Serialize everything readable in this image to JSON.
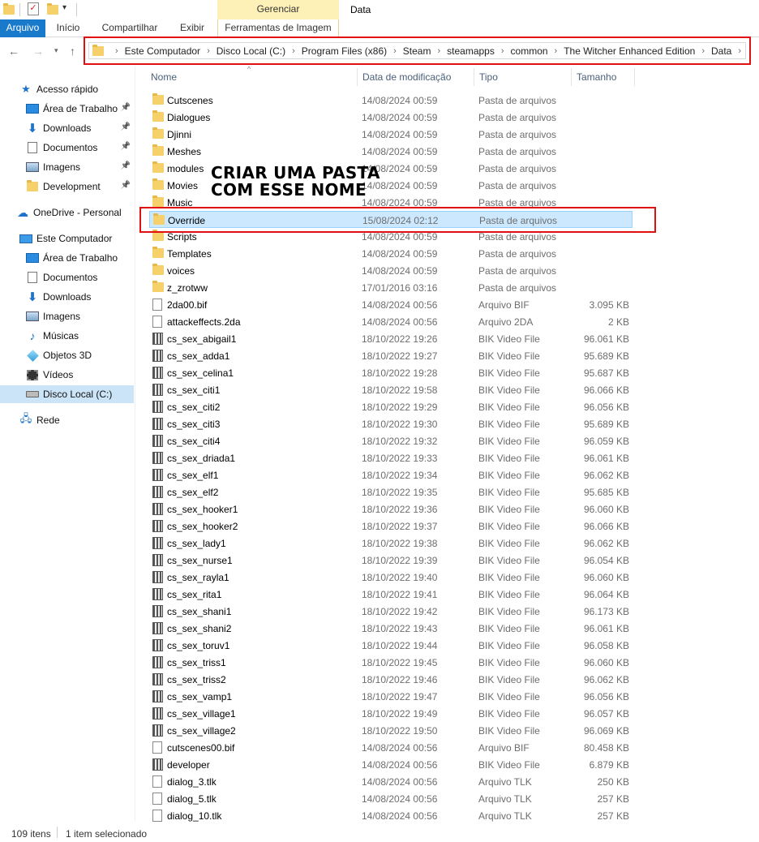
{
  "ribbon": {
    "manage_label": "Gerenciar",
    "window_title": "Data",
    "tabs": [
      "Arquivo",
      "Início",
      "Compartilhar",
      "Exibir"
    ],
    "manage_tab": "Ferramentas de Imagem"
  },
  "address": {
    "crumbs": [
      "Este Computador",
      "Disco Local (C:)",
      "Program Files (x86)",
      "Steam",
      "steamapps",
      "common",
      "The Witcher Enhanced Edition",
      "Data"
    ]
  },
  "sidebar": {
    "items": [
      {
        "label": "Acesso rápido",
        "icon": "star-icon",
        "pinned": false,
        "selected": false
      },
      {
        "label": "Área de Trabalho",
        "icon": "desktop-icon",
        "pinned": true,
        "selected": false
      },
      {
        "label": "Downloads",
        "icon": "download-icon",
        "pinned": true,
        "selected": false
      },
      {
        "label": "Documentos",
        "icon": "document-icon",
        "pinned": true,
        "selected": false
      },
      {
        "label": "Imagens",
        "icon": "image-icon",
        "pinned": true,
        "selected": false
      },
      {
        "label": "Development",
        "icon": "folder-icon",
        "pinned": true,
        "selected": false
      },
      {
        "label": "OneDrive - Personal",
        "icon": "cloud-icon",
        "pinned": false,
        "selected": false
      },
      {
        "label": "Este Computador",
        "icon": "computer-icon",
        "pinned": false,
        "selected": false
      },
      {
        "label": "Área de Trabalho",
        "icon": "desktop-icon",
        "pinned": false,
        "selected": false
      },
      {
        "label": "Documentos",
        "icon": "document-icon",
        "pinned": false,
        "selected": false
      },
      {
        "label": "Downloads",
        "icon": "download-icon",
        "pinned": false,
        "selected": false
      },
      {
        "label": "Imagens",
        "icon": "image-icon",
        "pinned": false,
        "selected": false
      },
      {
        "label": "Músicas",
        "icon": "music-icon",
        "pinned": false,
        "selected": false
      },
      {
        "label": "Objetos 3D",
        "icon": "cube-icon",
        "pinned": false,
        "selected": false
      },
      {
        "label": "Vídeos",
        "icon": "video-icon",
        "pinned": false,
        "selected": false
      },
      {
        "label": "Disco Local (C:)",
        "icon": "drive-icon",
        "pinned": false,
        "selected": true
      },
      {
        "label": "Rede",
        "icon": "network-icon",
        "pinned": false,
        "selected": false
      }
    ]
  },
  "columns": {
    "name": "Nome",
    "date": "Data de modificação",
    "type": "Tipo",
    "size": "Tamanho"
  },
  "files": [
    {
      "name": "Cutscenes",
      "date": "14/08/2024 00:59",
      "type": "Pasta de arquivos",
      "size": "",
      "kind": "folder"
    },
    {
      "name": "Dialogues",
      "date": "14/08/2024 00:59",
      "type": "Pasta de arquivos",
      "size": "",
      "kind": "folder"
    },
    {
      "name": "Djinni",
      "date": "14/08/2024 00:59",
      "type": "Pasta de arquivos",
      "size": "",
      "kind": "folder"
    },
    {
      "name": "Meshes",
      "date": "14/08/2024 00:59",
      "type": "Pasta de arquivos",
      "size": "",
      "kind": "folder"
    },
    {
      "name": "modules",
      "date": "14/08/2024 00:59",
      "type": "Pasta de arquivos",
      "size": "",
      "kind": "folder"
    },
    {
      "name": "Movies",
      "date": "14/08/2024 00:59",
      "type": "Pasta de arquivos",
      "size": "",
      "kind": "folder"
    },
    {
      "name": "Music",
      "date": "14/08/2024 00:59",
      "type": "Pasta de arquivos",
      "size": "",
      "kind": "folder"
    },
    {
      "name": "Override",
      "date": "15/08/2024 02:12",
      "type": "Pasta de arquivos",
      "size": "",
      "kind": "folder",
      "selected": true
    },
    {
      "name": "Scripts",
      "date": "14/08/2024 00:59",
      "type": "Pasta de arquivos",
      "size": "",
      "kind": "folder"
    },
    {
      "name": "Templates",
      "date": "14/08/2024 00:59",
      "type": "Pasta de arquivos",
      "size": "",
      "kind": "folder"
    },
    {
      "name": "voices",
      "date": "14/08/2024 00:59",
      "type": "Pasta de arquivos",
      "size": "",
      "kind": "folder"
    },
    {
      "name": "z_zrotww",
      "date": "17/01/2016 03:16",
      "type": "Pasta de arquivos",
      "size": "",
      "kind": "folder"
    },
    {
      "name": "2da00.bif",
      "date": "14/08/2024 00:56",
      "type": "Arquivo BIF",
      "size": "3.095 KB",
      "kind": "doc"
    },
    {
      "name": "attackeffects.2da",
      "date": "14/08/2024 00:56",
      "type": "Arquivo 2DA",
      "size": "2 KB",
      "kind": "doc"
    },
    {
      "name": "cs_sex_abigail1",
      "date": "18/10/2022 19:26",
      "type": "BIK Video File",
      "size": "96.061 KB",
      "kind": "bik"
    },
    {
      "name": "cs_sex_adda1",
      "date": "18/10/2022 19:27",
      "type": "BIK Video File",
      "size": "95.689 KB",
      "kind": "bik"
    },
    {
      "name": "cs_sex_celina1",
      "date": "18/10/2022 19:28",
      "type": "BIK Video File",
      "size": "95.687 KB",
      "kind": "bik"
    },
    {
      "name": "cs_sex_citi1",
      "date": "18/10/2022 19:58",
      "type": "BIK Video File",
      "size": "96.066 KB",
      "kind": "bik"
    },
    {
      "name": "cs_sex_citi2",
      "date": "18/10/2022 19:29",
      "type": "BIK Video File",
      "size": "96.056 KB",
      "kind": "bik"
    },
    {
      "name": "cs_sex_citi3",
      "date": "18/10/2022 19:30",
      "type": "BIK Video File",
      "size": "95.689 KB",
      "kind": "bik"
    },
    {
      "name": "cs_sex_citi4",
      "date": "18/10/2022 19:32",
      "type": "BIK Video File",
      "size": "96.059 KB",
      "kind": "bik"
    },
    {
      "name": "cs_sex_driada1",
      "date": "18/10/2022 19:33",
      "type": "BIK Video File",
      "size": "96.061 KB",
      "kind": "bik"
    },
    {
      "name": "cs_sex_elf1",
      "date": "18/10/2022 19:34",
      "type": "BIK Video File",
      "size": "96.062 KB",
      "kind": "bik"
    },
    {
      "name": "cs_sex_elf2",
      "date": "18/10/2022 19:35",
      "type": "BIK Video File",
      "size": "95.685 KB",
      "kind": "bik"
    },
    {
      "name": "cs_sex_hooker1",
      "date": "18/10/2022 19:36",
      "type": "BIK Video File",
      "size": "96.060 KB",
      "kind": "bik"
    },
    {
      "name": "cs_sex_hooker2",
      "date": "18/10/2022 19:37",
      "type": "BIK Video File",
      "size": "96.066 KB",
      "kind": "bik"
    },
    {
      "name": "cs_sex_lady1",
      "date": "18/10/2022 19:38",
      "type": "BIK Video File",
      "size": "96.062 KB",
      "kind": "bik"
    },
    {
      "name": "cs_sex_nurse1",
      "date": "18/10/2022 19:39",
      "type": "BIK Video File",
      "size": "96.054 KB",
      "kind": "bik"
    },
    {
      "name": "cs_sex_rayla1",
      "date": "18/10/2022 19:40",
      "type": "BIK Video File",
      "size": "96.060 KB",
      "kind": "bik"
    },
    {
      "name": "cs_sex_rita1",
      "date": "18/10/2022 19:41",
      "type": "BIK Video File",
      "size": "96.064 KB",
      "kind": "bik"
    },
    {
      "name": "cs_sex_shani1",
      "date": "18/10/2022 19:42",
      "type": "BIK Video File",
      "size": "96.173 KB",
      "kind": "bik"
    },
    {
      "name": "cs_sex_shani2",
      "date": "18/10/2022 19:43",
      "type": "BIK Video File",
      "size": "96.061 KB",
      "kind": "bik"
    },
    {
      "name": "cs_sex_toruv1",
      "date": "18/10/2022 19:44",
      "type": "BIK Video File",
      "size": "96.058 KB",
      "kind": "bik"
    },
    {
      "name": "cs_sex_triss1",
      "date": "18/10/2022 19:45",
      "type": "BIK Video File",
      "size": "96.060 KB",
      "kind": "bik"
    },
    {
      "name": "cs_sex_triss2",
      "date": "18/10/2022 19:46",
      "type": "BIK Video File",
      "size": "96.062 KB",
      "kind": "bik"
    },
    {
      "name": "cs_sex_vamp1",
      "date": "18/10/2022 19:47",
      "type": "BIK Video File",
      "size": "96.056 KB",
      "kind": "bik"
    },
    {
      "name": "cs_sex_village1",
      "date": "18/10/2022 19:49",
      "type": "BIK Video File",
      "size": "96.057 KB",
      "kind": "bik"
    },
    {
      "name": "cs_sex_village2",
      "date": "18/10/2022 19:50",
      "type": "BIK Video File",
      "size": "96.069 KB",
      "kind": "bik"
    },
    {
      "name": "cutscenes00.bif",
      "date": "14/08/2024 00:56",
      "type": "Arquivo BIF",
      "size": "80.458 KB",
      "kind": "doc"
    },
    {
      "name": "developer",
      "date": "14/08/2024 00:56",
      "type": "BIK Video File",
      "size": "6.879 KB",
      "kind": "bik"
    },
    {
      "name": "dialog_3.tlk",
      "date": "14/08/2024 00:56",
      "type": "Arquivo TLK",
      "size": "250 KB",
      "kind": "doc"
    },
    {
      "name": "dialog_5.tlk",
      "date": "14/08/2024 00:56",
      "type": "Arquivo TLK",
      "size": "257 KB",
      "kind": "doc"
    },
    {
      "name": "dialog_10.tlk",
      "date": "14/08/2024 00:56",
      "type": "Arquivo TLK",
      "size": "257 KB",
      "kind": "doc"
    }
  ],
  "annotation": {
    "line1": "CRIAR UMA PASTA",
    "line2": "COM ESSE NOME"
  },
  "status": {
    "count": "109 itens",
    "selected": "1 item selecionado"
  },
  "colors": {
    "accent": "#1979ca",
    "selection": "#cce8ff",
    "annotation_red": "#e01010",
    "manage_band": "#fdf1b8"
  }
}
